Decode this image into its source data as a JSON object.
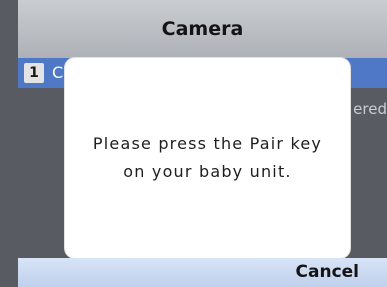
{
  "header": {
    "title": "Camera"
  },
  "list": {
    "row": {
      "index": "1",
      "label": "C",
      "status_text": "ered"
    }
  },
  "dialog": {
    "message": "Please press the Pair key on your baby unit."
  },
  "softkeys": {
    "right_label": "Cancel"
  }
}
